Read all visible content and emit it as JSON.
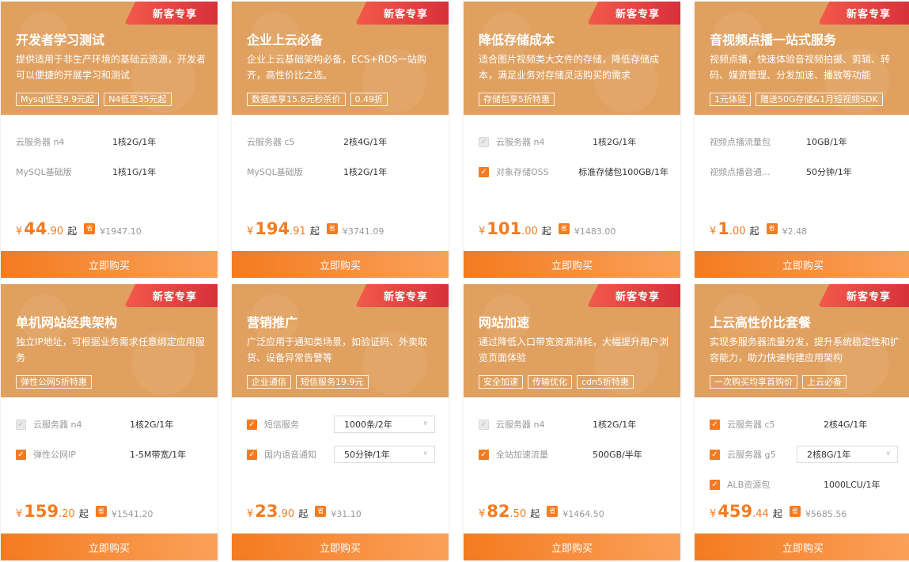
{
  "cards": [
    {
      "ribbon": "新客专享",
      "title": "开发者学习测试",
      "desc": "提供适用于非生产环境的基础云资源，开发者可以便捷的开展学习和测试",
      "tags": [
        "Mysql低至9.9元起",
        "N4低至35元起"
      ],
      "rows": [
        {
          "check": "none",
          "label": "云服务器 n4",
          "value": "1核2G/1年"
        },
        {
          "check": "none",
          "label": "MySQL基础版",
          "value": "1核1G/1年"
        }
      ],
      "price": {
        "yen": "¥",
        "int": "44",
        "dec": ".90",
        "suffix": "起",
        "badge": "省",
        "orig": "¥1947.10"
      },
      "button": "立即购买"
    },
    {
      "ribbon": "新客专享",
      "title": "企业上云必备",
      "desc": "企业上云基础架构必备，ECS+RDS一站购齐，高性价比之选。",
      "tags": [
        "数据库享15.8元秒杀价",
        "0.49折"
      ],
      "rows": [
        {
          "check": "none",
          "label": "云服务器 c5",
          "value": "2核4G/1年"
        },
        {
          "check": "none",
          "label": "MySQL基础版",
          "value": "1核2G/1年"
        }
      ],
      "price": {
        "yen": "¥",
        "int": "194",
        "dec": ".91",
        "suffix": "起",
        "badge": "省",
        "orig": "¥3741.09"
      },
      "button": "立即购买"
    },
    {
      "ribbon": "新客专享",
      "title": "降低存储成本",
      "desc": "适合图片视频类大文件的存储，降低存储成本，满足业务对存储灵活购买的需求",
      "tags": [
        "存储包享5折特惠"
      ],
      "rows": [
        {
          "check": "disabled",
          "label": "云服务器 n4",
          "value": "1核2G/1年"
        },
        {
          "check": "on",
          "label": "对象存储OSS",
          "value": "标准存储包100GB/1年"
        }
      ],
      "price": {
        "yen": "¥",
        "int": "101",
        "dec": ".00",
        "suffix": "起",
        "badge": "省",
        "orig": "¥1483.00"
      },
      "button": "立即购买"
    },
    {
      "ribbon": "新客专享",
      "title": "音视频点播一站式服务",
      "desc": "视频点播，快速体验音视频拍摄、剪辑、转码、媒资管理、分发加速、播放等功能",
      "tags": [
        "1元体验",
        "赠送50G存储&1月短视频SDK"
      ],
      "rows": [
        {
          "check": "none",
          "label": "视频点播流量包",
          "value": "10GB/1年"
        },
        {
          "check": "none",
          "label": "视频点播音通...",
          "value": "50分钟/1年"
        }
      ],
      "price": {
        "yen": "¥",
        "int": "1",
        "dec": ".00",
        "suffix": "起",
        "badge": "省",
        "orig": "¥2.48"
      },
      "button": "立即购买"
    },
    {
      "ribbon": "新客专享",
      "title": "单机网站经典架构",
      "desc": "独立IP地址，可根据业务需求任意绑定应用服务",
      "tags": [
        "弹性公网5折特惠"
      ],
      "rows": [
        {
          "check": "disabled",
          "label": "云服务器 n4",
          "value": "1核2G/1年"
        },
        {
          "check": "on",
          "label": "弹性公网IP",
          "value": "1-5M带宽/1年"
        }
      ],
      "price": {
        "yen": "¥",
        "int": "159",
        "dec": ".20",
        "suffix": "起",
        "badge": "省",
        "orig": "¥1541.20"
      },
      "button": "立即购买"
    },
    {
      "ribbon": "新客专享",
      "title": "营销推广",
      "desc": "广泛应用于通知类场景，如验证码、外卖取货、设备异常告警等",
      "tags": [
        "企业通信",
        "短信服务19.9元"
      ],
      "rows": [
        {
          "check": "on",
          "label": "短信服务",
          "value": "1000条/2年",
          "select": true
        },
        {
          "check": "on",
          "label": "国内语音通知",
          "value": "50分钟/1年",
          "select": true
        }
      ],
      "price": {
        "yen": "¥",
        "int": "23",
        "dec": ".90",
        "suffix": "起",
        "badge": "省",
        "orig": "¥31.10"
      },
      "button": "立即购买"
    },
    {
      "ribbon": "新客专享",
      "title": "网站加速",
      "desc": "通过降低入口带宽资源消耗，大幅提升用户浏览页面体验",
      "tags": [
        "安全加速",
        "传输优化",
        "cdn5折特惠"
      ],
      "rows": [
        {
          "check": "disabled",
          "label": "云服务器 n4",
          "value": "1核2G/1年"
        },
        {
          "check": "on",
          "label": "全站加速流量",
          "value": "500GB/半年"
        }
      ],
      "price": {
        "yen": "¥",
        "int": "82",
        "dec": ".50",
        "suffix": "起",
        "badge": "省",
        "orig": "¥1464.50"
      },
      "button": "立即购买"
    },
    {
      "ribbon": "新客专享",
      "title": "上云高性价比套餐",
      "desc": "实现多服务器流量分发，提升系统稳定性和扩容能力，助力快速构建应用架构",
      "tags": [
        "一次购买均享首购价",
        "上云必备"
      ],
      "rows": [
        {
          "check": "on",
          "label": "云服务器 c5",
          "value": "2核4G/1年"
        },
        {
          "check": "on",
          "label": "云服务器 g5",
          "value": "2核8G/1年",
          "select": true
        },
        {
          "check": "on",
          "label": "ALB资源包",
          "value": "1000LCU/1年"
        }
      ],
      "price": {
        "yen": "¥",
        "int": "459",
        "dec": ".44",
        "suffix": "起",
        "badge": "省",
        "orig": "¥5685.56"
      },
      "button": "立即购买"
    }
  ]
}
